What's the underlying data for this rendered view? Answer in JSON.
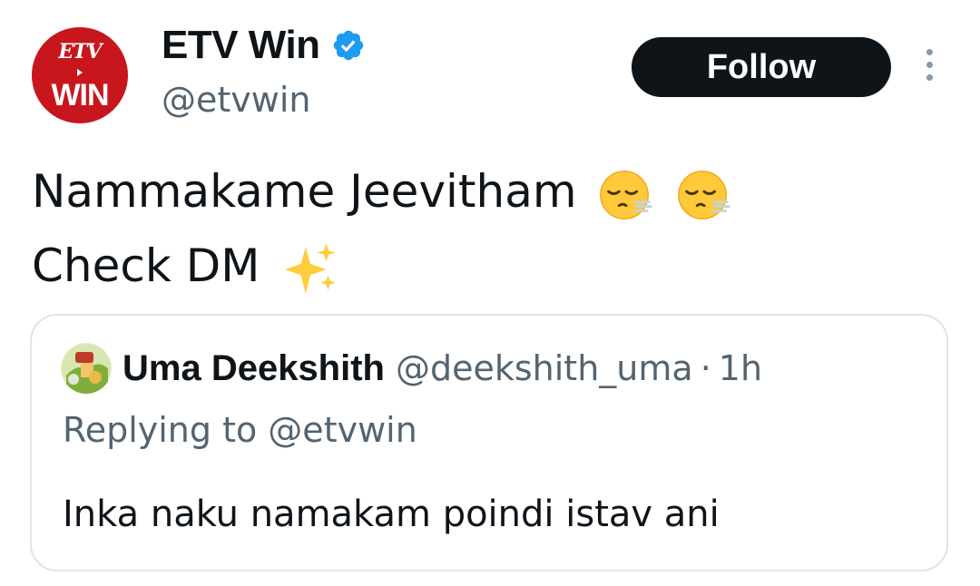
{
  "account": {
    "display_name": "ETV Win",
    "handle": "@etvwin",
    "avatar_logo_top": "ETV",
    "avatar_logo_bottom": "WIN",
    "verified": true,
    "verified_color": "#1d9bf0"
  },
  "actions": {
    "follow_label": "Follow",
    "more_icon": "more-vertical-icon"
  },
  "tweet": {
    "line1_text": "Nammakame Jeevitham",
    "line1_emojis": [
      "face-exhaling-emoji",
      "face-exhaling-emoji"
    ],
    "line2_text": "Check DM",
    "line2_emojis": [
      "sparkles-emoji"
    ]
  },
  "quoted_tweet": {
    "display_name": "Uma Deekshith",
    "handle": "@deekshith_uma",
    "separator": "·",
    "time": "1h",
    "replying_to": "Replying to @etvwin",
    "text": "Inka naku namakam poindi istav ani"
  },
  "colors": {
    "text_primary": "#0f1419",
    "text_secondary": "#536471",
    "follow_bg": "#0f1419",
    "brand_red": "#c8161d",
    "card_border": "#dfe4e8"
  }
}
